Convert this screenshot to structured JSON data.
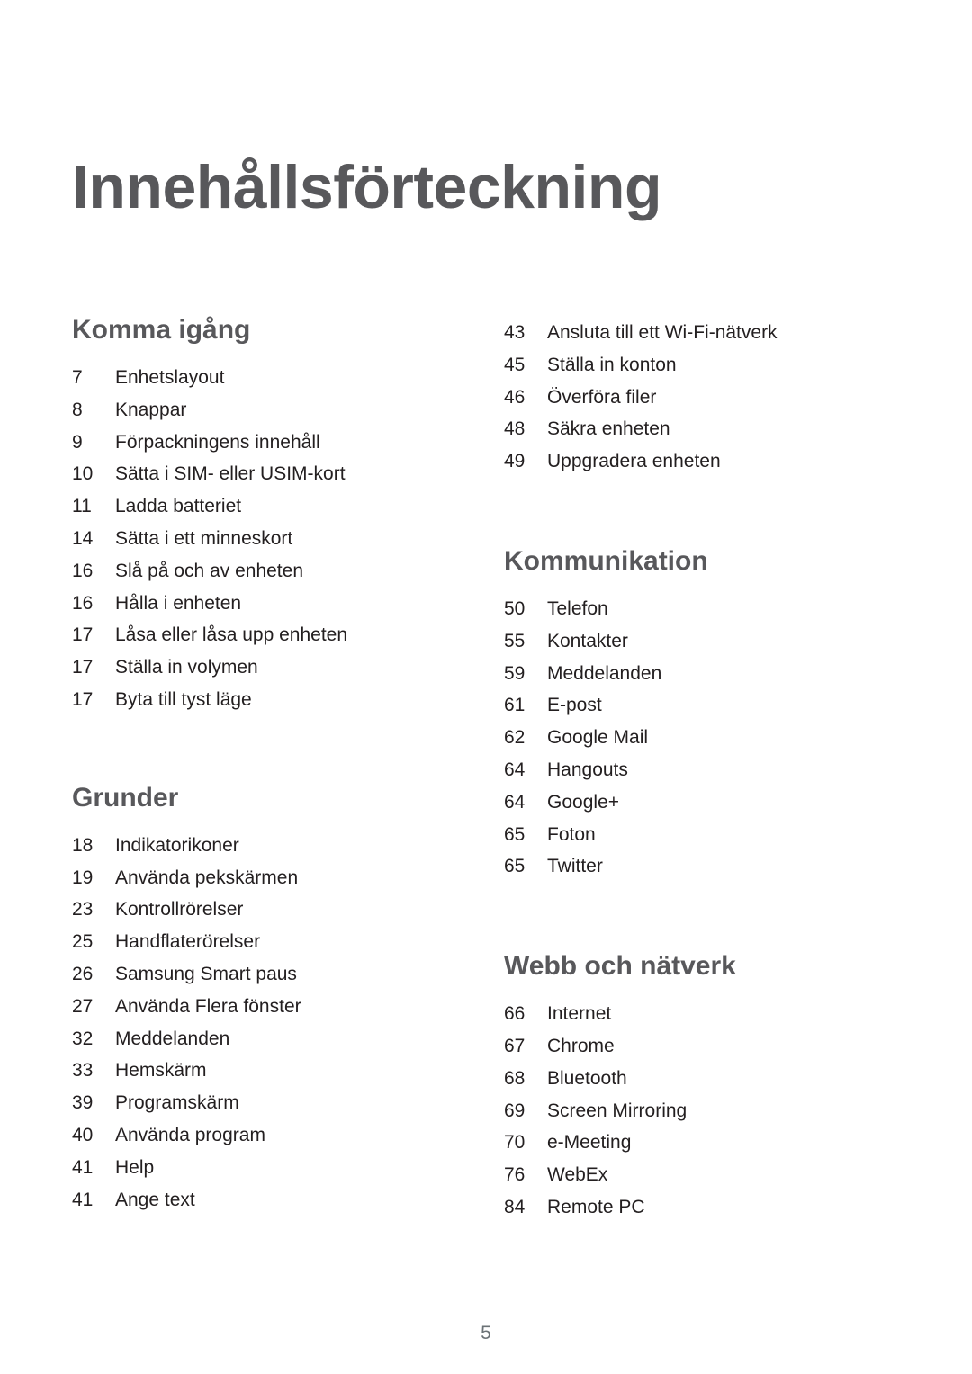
{
  "document": {
    "title": "Innehållsförteckning",
    "page_number": "5"
  },
  "colors": {
    "heading": "#58585b",
    "body_text": "#231f20",
    "page_number": "#6b7276",
    "background": "#ffffff"
  },
  "columns": {
    "left": [
      {
        "heading": "Komma igång",
        "entries": [
          {
            "page": "7",
            "label": "Enhetslayout"
          },
          {
            "page": "8",
            "label": "Knappar"
          },
          {
            "page": "9",
            "label": "Förpackningens innehåll"
          },
          {
            "page": "10",
            "label": "Sätta i SIM- eller USIM-kort"
          },
          {
            "page": "11",
            "label": "Ladda batteriet"
          },
          {
            "page": "14",
            "label": "Sätta i ett minneskort"
          },
          {
            "page": "16",
            "label": "Slå på och av enheten"
          },
          {
            "page": "16",
            "label": "Hålla i enheten"
          },
          {
            "page": "17",
            "label": "Låsa eller låsa upp enheten"
          },
          {
            "page": "17",
            "label": "Ställa in volymen"
          },
          {
            "page": "17",
            "label": "Byta till tyst läge"
          }
        ]
      },
      {
        "heading": "Grunder",
        "entries": [
          {
            "page": "18",
            "label": "Indikatorikoner"
          },
          {
            "page": "19",
            "label": "Använda pekskärmen"
          },
          {
            "page": "23",
            "label": "Kontrollrörelser"
          },
          {
            "page": "25",
            "label": "Handflaterörelser"
          },
          {
            "page": "26",
            "label": "Samsung Smart paus"
          },
          {
            "page": "27",
            "label": "Använda Flera fönster"
          },
          {
            "page": "32",
            "label": "Meddelanden"
          },
          {
            "page": "33",
            "label": "Hemskärm"
          },
          {
            "page": "39",
            "label": "Programskärm"
          },
          {
            "page": "40",
            "label": "Använda program"
          },
          {
            "page": "41",
            "label": "Help"
          },
          {
            "page": "41",
            "label": "Ange text"
          }
        ]
      }
    ],
    "right": [
      {
        "heading": "",
        "entries": [
          {
            "page": "43",
            "label": "Ansluta till ett Wi-Fi-nätverk"
          },
          {
            "page": "45",
            "label": "Ställa in konton"
          },
          {
            "page": "46",
            "label": "Överföra filer"
          },
          {
            "page": "48",
            "label": "Säkra enheten"
          },
          {
            "page": "49",
            "label": "Uppgradera enheten"
          }
        ]
      },
      {
        "heading": "Kommunikation",
        "entries": [
          {
            "page": "50",
            "label": "Telefon"
          },
          {
            "page": "55",
            "label": "Kontakter"
          },
          {
            "page": "59",
            "label": "Meddelanden"
          },
          {
            "page": "61",
            "label": "E-post"
          },
          {
            "page": "62",
            "label": "Google Mail"
          },
          {
            "page": "64",
            "label": "Hangouts"
          },
          {
            "page": "64",
            "label": "Google+"
          },
          {
            "page": "65",
            "label": "Foton"
          },
          {
            "page": "65",
            "label": "Twitter"
          }
        ]
      },
      {
        "heading": "Webb och nätverk",
        "entries": [
          {
            "page": "66",
            "label": "Internet"
          },
          {
            "page": "67",
            "label": "Chrome"
          },
          {
            "page": "68",
            "label": "Bluetooth"
          },
          {
            "page": "69",
            "label": "Screen Mirroring"
          },
          {
            "page": "70",
            "label": "e-Meeting"
          },
          {
            "page": "76",
            "label": "WebEx"
          },
          {
            "page": "84",
            "label": "Remote PC"
          }
        ]
      }
    ]
  }
}
